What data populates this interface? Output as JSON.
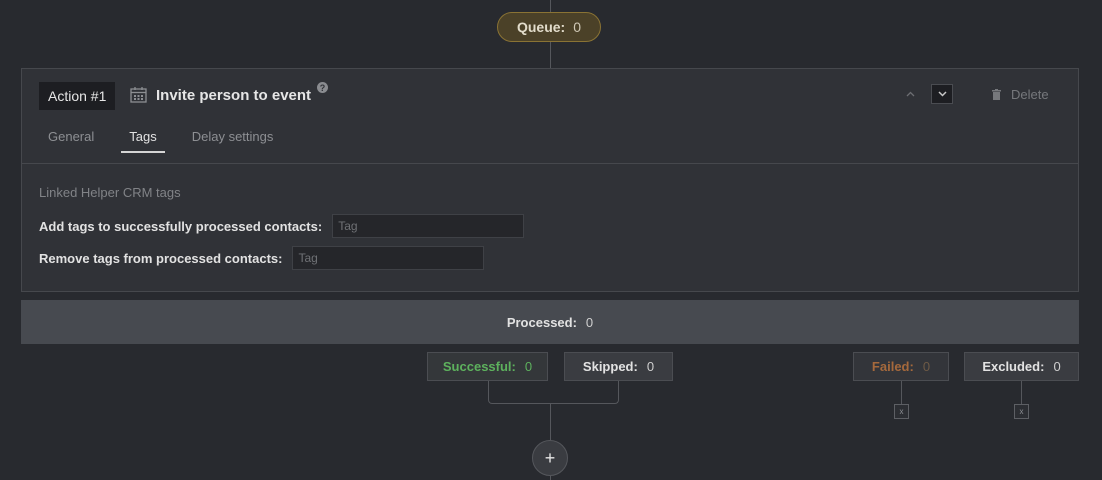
{
  "queue": {
    "label": "Queue:",
    "count": "0"
  },
  "action": {
    "badge": "Action #1",
    "title": "Invite person to event",
    "help": "?",
    "delete_label": "Delete"
  },
  "tabs": [
    {
      "label": "General"
    },
    {
      "label": "Tags"
    },
    {
      "label": "Delay settings"
    }
  ],
  "active_tab": "Tags",
  "tags_section": {
    "heading": "Linked Helper CRM tags",
    "add_label": "Add tags to successfully processed contacts:",
    "add_placeholder": "Tag",
    "remove_label": "Remove tags from processed contacts:",
    "remove_placeholder": "Tag"
  },
  "processed": {
    "label": "Processed:",
    "count": "0"
  },
  "stats": {
    "successful": {
      "label": "Successful:",
      "count": "0"
    },
    "skipped": {
      "label": "Skipped:",
      "count": "0"
    },
    "failed": {
      "label": "Failed:",
      "count": "0"
    },
    "excluded": {
      "label": "Excluded:",
      "count": "0"
    }
  },
  "remove_glyph": "x",
  "add_glyph": "+",
  "colors": {
    "background": "#282a2f",
    "queue_accent": "#8a7334",
    "success": "#5db15d",
    "failed": "#a5693c"
  },
  "icons": [
    "calendar-icon",
    "help-icon",
    "chevron-up-icon",
    "chevron-down-icon",
    "trash-icon",
    "plus-icon",
    "close-icon"
  ]
}
